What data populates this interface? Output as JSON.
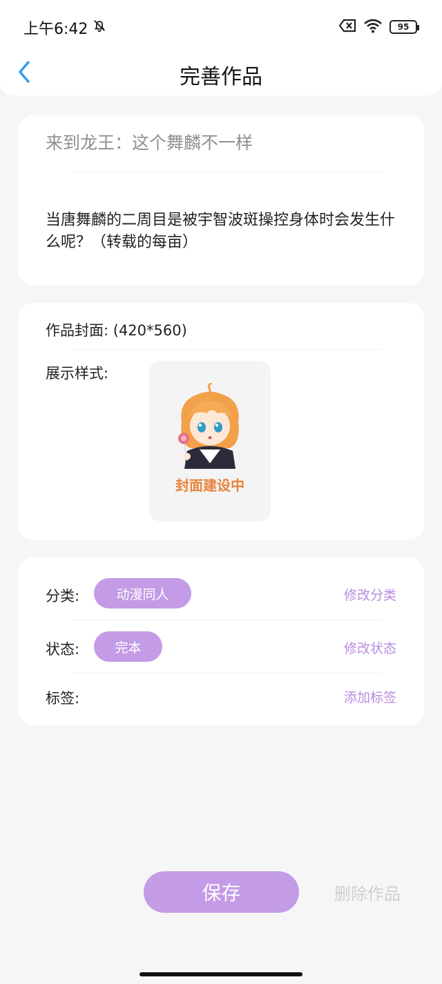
{
  "status_bar": {
    "time": "上午6:42",
    "battery": "95"
  },
  "header": {
    "title": "完善作品"
  },
  "work": {
    "title": "来到龙王：这个舞麟不一样",
    "description": "当唐舞麟的二周目是被宇智波斑操控身体时会发生什么呢？（转载的每亩）"
  },
  "cover": {
    "label": "作品封面: (420*560)",
    "style_label": "展示样式:",
    "placeholder_text": "封面建设中"
  },
  "meta": {
    "category_label": "分类:",
    "category_value": "动漫同人",
    "category_action": "修改分类",
    "status_label": "状态:",
    "status_value": "完本",
    "status_action": "修改状态",
    "tags_label": "标签:",
    "tags_action": "添加标签"
  },
  "footer": {
    "save_label": "保存",
    "delete_label": "删除作品"
  },
  "colors": {
    "accent": "#c39be6",
    "link": "#b88ce0",
    "back": "#2b9cf0",
    "cover_text": "#e8823a"
  }
}
